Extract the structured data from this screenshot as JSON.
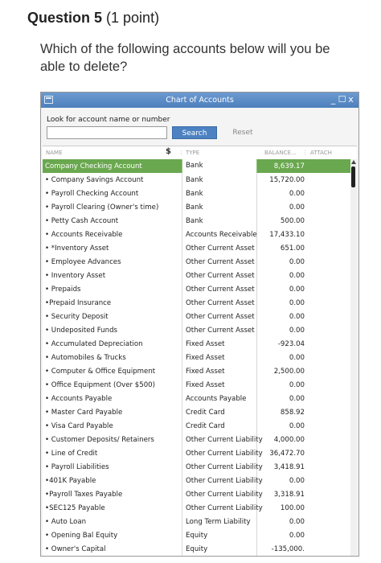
{
  "question": {
    "title_bold": "Question 5",
    "title_points": "(1 point)",
    "text": "Which of the following accounts below will you be able to delete?"
  },
  "window": {
    "title": "Chart of Accounts",
    "controls": [
      "_",
      "☐",
      "x"
    ],
    "look_label": "Look for account name or number",
    "search_value": "",
    "search_button": "Search",
    "reset_button": "Reset"
  },
  "table": {
    "headers": {
      "name": "NAME",
      "dollar": "$",
      "type": "TYPE",
      "balance": "BALANCE...",
      "attach": "ATTACH"
    },
    "rows": [
      {
        "name": "Company Checking Account",
        "type": "Bank",
        "balance": "8,639.17",
        "selected": true
      },
      {
        "name": "• Company Savings Account",
        "type": "Bank",
        "balance": "15,720.00"
      },
      {
        "name": "• Payroll Checking Account",
        "type": "Bank",
        "balance": "0.00"
      },
      {
        "name": "• Payroll Clearing (Owner's time)",
        "type": "Bank",
        "balance": "0.00"
      },
      {
        "name": "• Petty Cash Account",
        "type": "Bank",
        "balance": "500.00"
      },
      {
        "name": "• Accounts Receivable",
        "type": "Accounts Receivable",
        "balance": "17,433.10"
      },
      {
        "name": "• *Inventory Asset",
        "type": "Other Current Asset",
        "balance": "651.00"
      },
      {
        "name": "• Employee Advances",
        "type": "Other Current Asset",
        "balance": "0.00"
      },
      {
        "name": "• Inventory Asset",
        "type": "Other Current Asset",
        "balance": "0.00"
      },
      {
        "name": "• Prepaids",
        "type": "Other Current Asset",
        "balance": "0.00"
      },
      {
        "name": "   •Prepaid Insurance",
        "type": "Other Current Asset",
        "balance": "0.00"
      },
      {
        "name": "• Security Deposit",
        "type": "Other Current Asset",
        "balance": "0.00"
      },
      {
        "name": "• Undeposited Funds",
        "type": "Other Current Asset",
        "balance": "0.00"
      },
      {
        "name": "• Accumulated Depreciation",
        "type": "Fixed Asset",
        "balance": "-923.04"
      },
      {
        "name": "• Automobiles & Trucks",
        "type": "Fixed Asset",
        "balance": "0.00"
      },
      {
        "name": "• Computer & Office Equipment",
        "type": "Fixed Asset",
        "balance": "2,500.00"
      },
      {
        "name": "• Office Equipment (Over $500)",
        "type": "Fixed Asset",
        "balance": "0.00"
      },
      {
        "name": "• Accounts Payable",
        "type": "Accounts Payable",
        "balance": "0.00"
      },
      {
        "name": "• Master Card Payable",
        "type": "Credit Card",
        "balance": "858.92"
      },
      {
        "name": "• Visa Card Payable",
        "type": "Credit Card",
        "balance": "0.00"
      },
      {
        "name": "• Customer Deposits/ Retainers",
        "type": "Other Current Liability",
        "balance": "4,000.00"
      },
      {
        "name": "• Line of Credit",
        "type": "Other Current Liability",
        "balance": "36,472.70"
      },
      {
        "name": "• Payroll Liabilities",
        "type": "Other Current Liability",
        "balance": "3,418.91"
      },
      {
        "name": "   •401K Payable",
        "type": "Other Current Liability",
        "balance": "0.00"
      },
      {
        "name": "   •Payroll Taxes Payable",
        "type": "Other Current Liability",
        "balance": "3,318.91"
      },
      {
        "name": "   •SEC125 Payable",
        "type": "Other Current Liability",
        "balance": "100.00"
      },
      {
        "name": "• Auto Loan",
        "type": "Long Term Liability",
        "balance": "0.00"
      },
      {
        "name": "• Opening Bal Equity",
        "type": "Equity",
        "balance": "0.00"
      },
      {
        "name": "• Owner's Capital",
        "type": "Equity",
        "balance": "-135,000."
      }
    ]
  }
}
